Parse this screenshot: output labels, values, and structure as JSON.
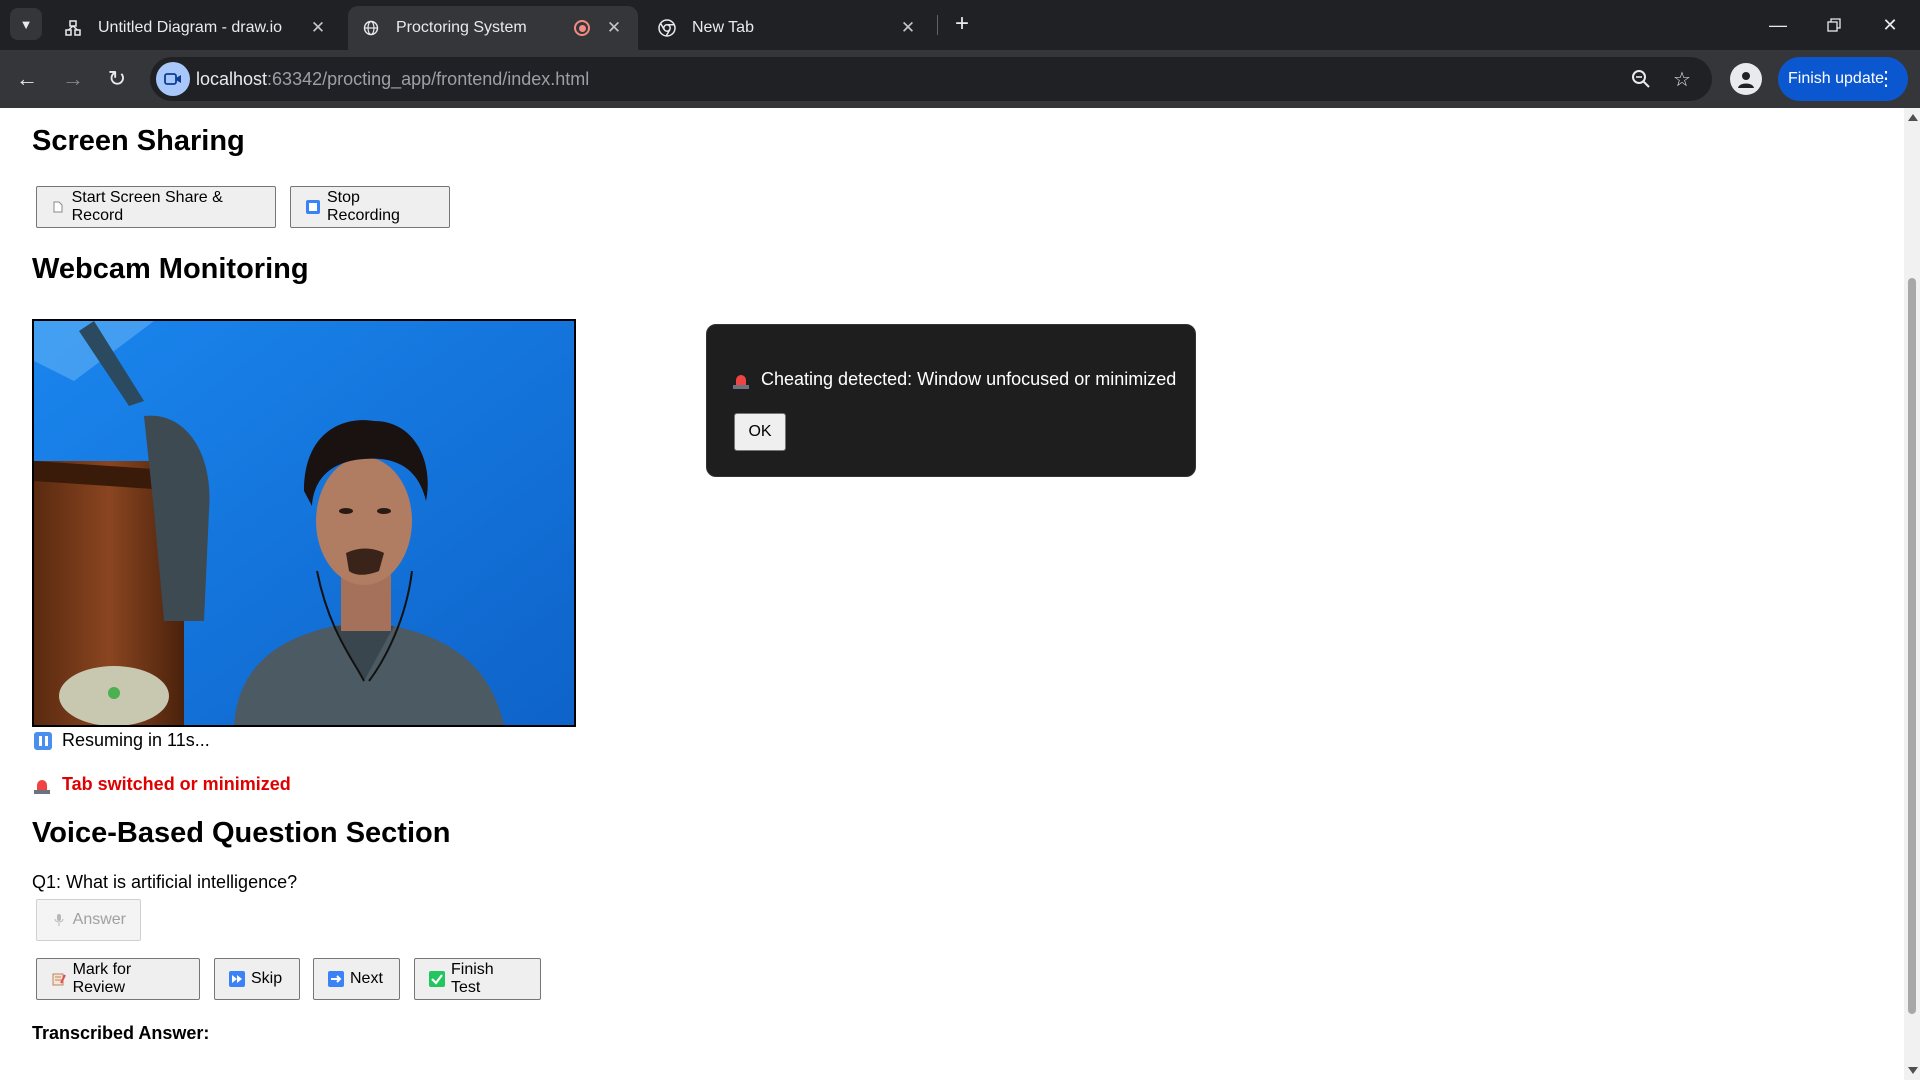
{
  "browser": {
    "tabs": [
      {
        "title": "Untitled Diagram - draw.io",
        "active": false
      },
      {
        "title": "Proctoring System",
        "active": true,
        "recording": true
      },
      {
        "title": "New Tab",
        "active": false
      }
    ],
    "url_host": "localhost",
    "url_path": ":63342/procting_app/frontend/index.html",
    "update_button": "Finish update",
    "icons": [
      "tab-search-icon",
      "back-icon",
      "forward-icon",
      "reload-icon",
      "zoom-icon",
      "star-icon",
      "profile-icon",
      "more-icon",
      "minimize-icon",
      "restore-icon",
      "close-icon"
    ]
  },
  "page": {
    "screen_sharing": {
      "heading": "Screen Sharing",
      "start_button": "Start Screen Share & Record",
      "stop_button": "Stop Recording"
    },
    "webcam": {
      "heading": "Webcam Monitoring",
      "status": "Resuming in 11s...",
      "alert": "Tab switched or minimized"
    },
    "voice": {
      "heading": "Voice-Based Question Section",
      "question": "Q1: What is artificial intelligence?",
      "answer_button": "Answer",
      "mark_button": "Mark for Review",
      "skip_button": "Skip",
      "next_button": "Next",
      "finish_button": "Finish Test",
      "transcribed_label": "Transcribed Answer:",
      "transcribed_value": "..."
    },
    "modal": {
      "message": "Cheating detected: Window unfocused or minimized",
      "ok_button": "OK"
    }
  },
  "colors": {
    "alert_red": "#e00000",
    "chrome_dark": "#202124",
    "update_blue": "#0b57d0",
    "webcam_wall": "#1679e0"
  }
}
